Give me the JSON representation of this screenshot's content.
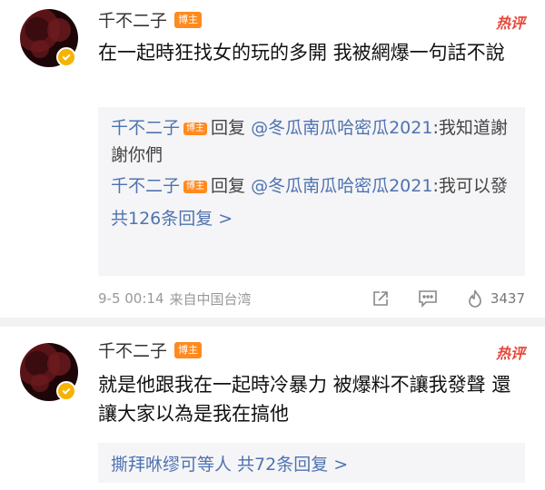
{
  "comments": [
    {
      "username": "千不二子",
      "owner_tag": "博主",
      "hot_label": "热评",
      "text": "在一起時狂找女的玩的多開 我被網爆一句話不說",
      "replies": [
        {
          "name": "千不二子",
          "tag": "博主",
          "prefix": "回复",
          "at": "@冬瓜南瓜哈密瓜2021",
          "text": ":我知道謝謝你們"
        },
        {
          "name": "千不二子",
          "tag": "博主",
          "prefix": "回复",
          "at": "@冬瓜南瓜哈密瓜2021",
          "text": ":我可以發"
        }
      ],
      "more_replies": "共126条回复 >",
      "time": "9-5 00:14",
      "location": "来自中国台湾",
      "likes": "3437"
    },
    {
      "username": "千不二子",
      "owner_tag": "博主",
      "hot_label": "热评",
      "text": "就是他跟我在一起時冷暴力 被爆料不讓我發聲 還讓大家以為是我在搞他",
      "reply_summary": "撕拜咻缪可等人 共72条回复 >"
    }
  ],
  "colors": {
    "link": "#4f73b0",
    "hot": "#e8473a",
    "tag": "#ff8a1f",
    "badge": "#f6b300"
  }
}
